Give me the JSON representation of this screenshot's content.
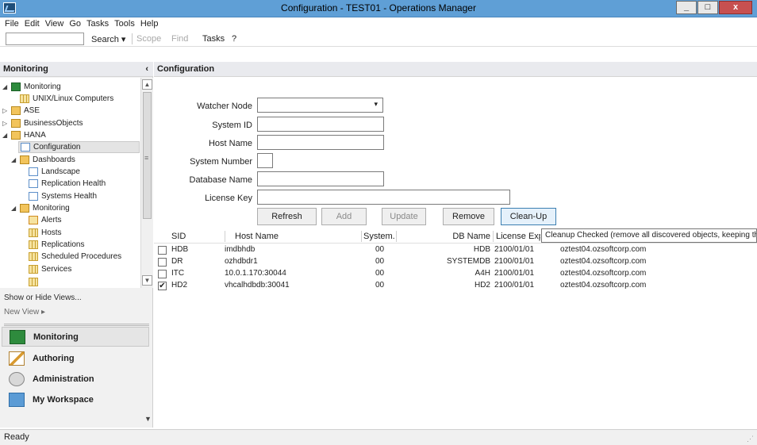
{
  "window": {
    "title": "Configuration - TEST01 - Operations Manager",
    "buttons": {
      "minimize": "_",
      "maximize": "□",
      "close": "x"
    }
  },
  "menu": [
    "File",
    "Edit",
    "View",
    "Go",
    "Tasks",
    "Tools",
    "Help"
  ],
  "toolbar": {
    "search": "Search",
    "scope": "Scope",
    "find": "Find",
    "tasks": "Tasks",
    "search_value": ""
  },
  "left": {
    "header": "Monitoring",
    "tree": [
      {
        "label": "Monitoring",
        "expander": "◢",
        "icon": "green",
        "level": 0
      },
      {
        "label": "UNIX/Linux Computers",
        "expander": "",
        "icon": "grid",
        "level": 1
      },
      {
        "label": "ASE",
        "expander": "▷",
        "icon": "folder",
        "level": 0
      },
      {
        "label": "BusinessObjects",
        "expander": "▷",
        "icon": "folder",
        "level": 0
      },
      {
        "label": "HANA",
        "expander": "◢",
        "icon": "folder",
        "level": 0
      },
      {
        "label": "Configuration",
        "expander": "",
        "icon": "view",
        "level": 1,
        "selected": true
      },
      {
        "label": "Dashboards",
        "expander": "◢",
        "icon": "folder",
        "level": 1
      },
      {
        "label": "Landscape",
        "expander": "",
        "icon": "view",
        "level": 2
      },
      {
        "label": "Replication Health",
        "expander": "",
        "icon": "view",
        "level": 2
      },
      {
        "label": "Systems Health",
        "expander": "",
        "icon": "view",
        "level": 2
      },
      {
        "label": "Monitoring",
        "expander": "◢",
        "icon": "folder",
        "level": 1
      },
      {
        "label": "Alerts",
        "expander": "",
        "icon": "alert",
        "level": 2
      },
      {
        "label": "Hosts",
        "expander": "",
        "icon": "grid",
        "level": 2
      },
      {
        "label": "Replications",
        "expander": "",
        "icon": "grid",
        "level": 2
      },
      {
        "label": "Scheduled Procedures",
        "expander": "",
        "icon": "grid",
        "level": 2
      },
      {
        "label": "Services",
        "expander": "",
        "icon": "grid",
        "level": 2
      }
    ],
    "show_hide": "Show or Hide Views...",
    "new_view": "New View ▸",
    "wunderbar": [
      {
        "label": "Monitoring",
        "icon": "mon",
        "selected": true
      },
      {
        "label": "Authoring",
        "icon": "auth"
      },
      {
        "label": "Administration",
        "icon": "admin"
      },
      {
        "label": "My Workspace",
        "icon": "ws"
      }
    ]
  },
  "main": {
    "header": "Configuration",
    "form": {
      "watcher_node_label": "Watcher Node",
      "watcher_node_value": "",
      "system_id_label": "System ID",
      "system_id_value": "",
      "host_name_label": "Host Name",
      "host_name_value": "",
      "system_number_label": "System Number",
      "system_number_value": "",
      "database_name_label": "Database Name",
      "database_name_value": "",
      "license_key_label": "License Key",
      "license_key_value": ""
    },
    "buttons": {
      "refresh": "Refresh",
      "add": "Add",
      "update": "Update",
      "remove": "Remove",
      "cleanup": "Clean-Up"
    },
    "tooltip": "Cleanup Checked (remove all discovered objects, keeping the s",
    "columns": {
      "sid": "SID",
      "host": "Host Name",
      "system": "System...",
      "db": "DB Name",
      "license": "License Expira"
    },
    "rows": [
      {
        "checked": "",
        "sid": "HDB",
        "host": "imdbhdb",
        "system": "00",
        "db": "HDB",
        "license": "2100/01/01",
        "watcher": "oztest04.ozsoftcorp.com"
      },
      {
        "checked": "",
        "sid": "DR",
        "host": "ozhdbdr1",
        "system": "00",
        "db": "SYSTEMDB",
        "license": "2100/01/01",
        "watcher": "oztest04.ozsoftcorp.com"
      },
      {
        "checked": "",
        "sid": "ITC",
        "host": "10.0.1.170:30044",
        "system": "00",
        "db": "A4H",
        "license": "2100/01/01",
        "watcher": "oztest04.ozsoftcorp.com"
      },
      {
        "checked": "✔",
        "sid": "HD2",
        "host": "vhcalhdbdb:30041",
        "system": "00",
        "db": "HD2",
        "license": "2100/01/01",
        "watcher": "oztest04.ozsoftcorp.com"
      }
    ]
  },
  "status": {
    "text": "Ready"
  }
}
